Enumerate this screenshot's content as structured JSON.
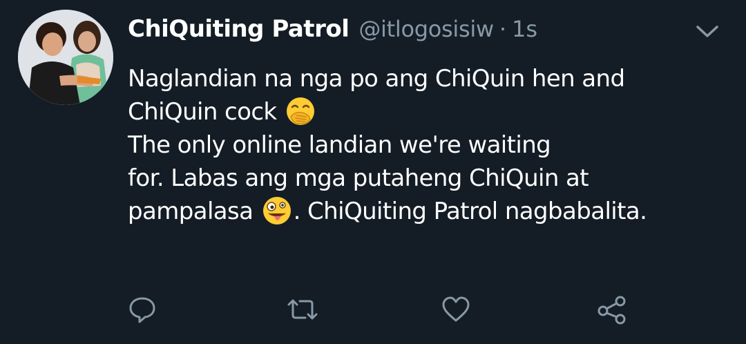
{
  "tweet": {
    "display_name": "ChiQuiting Patrol",
    "handle": "@itlogosisiw",
    "separator": "·",
    "time": "1s",
    "lines": [
      {
        "text_before": "Naglandian na nga po ang ChiQuin  hen and",
        "emoji": null,
        "text_after": ""
      },
      {
        "text_before": "ChiQuin cock ",
        "emoji": "face-with-hand-over-mouth-emoji",
        "text_after": ""
      },
      {
        "text_before": "The only online landian we're waiting",
        "emoji": null,
        "text_after": ""
      },
      {
        "text_before": "for. Labas ang mga putaheng ChiQuin at",
        "emoji": null,
        "text_after": ""
      },
      {
        "text_before": "pampalasa ",
        "emoji": "zany-face-emoji",
        "text_after": ". ChiQuiting Patrol nagbabalita."
      }
    ]
  },
  "icons": {
    "menu": "chevron-down-icon",
    "reply": "reply-icon",
    "retweet": "retweet-icon",
    "like": "heart-icon",
    "share": "share-icon"
  },
  "colors": {
    "background": "#141d26",
    "primary_text": "#ffffff",
    "secondary_text": "#8899a6",
    "icon": "#8899a6"
  }
}
